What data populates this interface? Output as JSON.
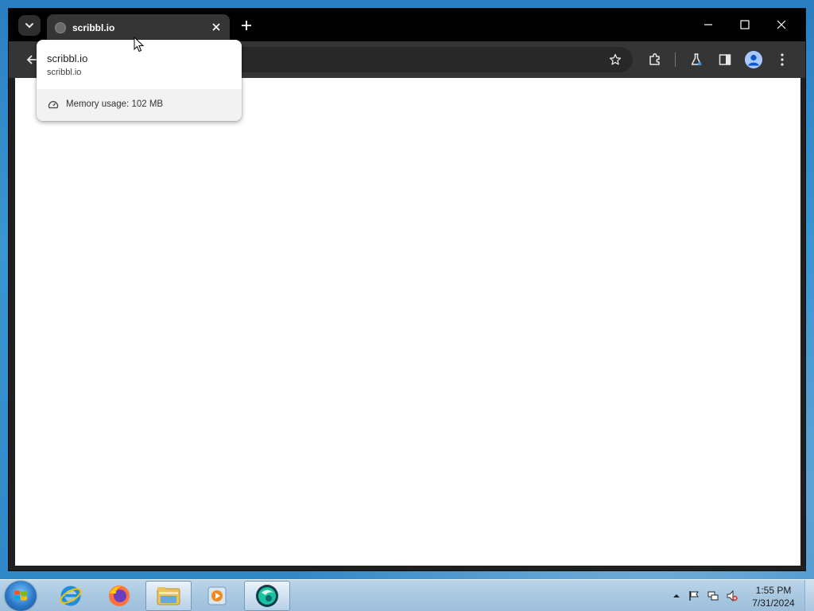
{
  "browser": {
    "tab": {
      "title": "scribbl.io"
    },
    "hover_card": {
      "title": "scribbl.io",
      "domain": "scribbl.io",
      "memory_usage": "Memory usage: 102 MB"
    },
    "toolbar": {
      "icons": [
        "back-arrow-icon",
        "star-icon",
        "extensions-icon",
        "labs-flask-icon",
        "side-panel-icon",
        "profile-icon",
        "more-menu-icon"
      ]
    },
    "window_controls": [
      "minimize-icon",
      "maximize-icon",
      "close-icon"
    ]
  },
  "taskbar": {
    "apps": [
      "internet-explorer",
      "firefox",
      "file-explorer",
      "media-player",
      "app-green-circle"
    ],
    "tray_icons": [
      "show-hidden-icons-arrow",
      "action-center-flag",
      "network-icon",
      "volume-muted-icon"
    ],
    "clock": {
      "time": "1:55 PM",
      "date": "7/31/2024"
    }
  },
  "colors": {
    "tabstrip": "#000000",
    "toolbar": "#353535",
    "taskbar": "#a9c8e1",
    "desktop": "#2f86c6"
  }
}
